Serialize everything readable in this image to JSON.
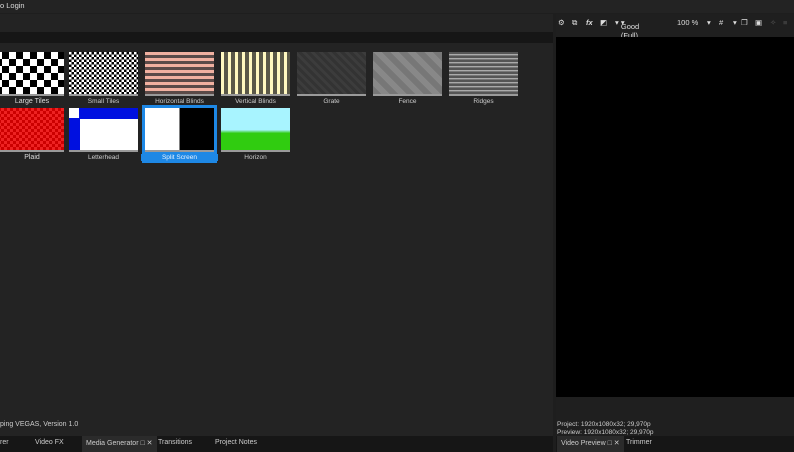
{
  "topbar": {
    "text": "o Login"
  },
  "media": [
    {
      "label": "Large Tiles"
    },
    {
      "label": "Small Tiles"
    },
    {
      "label": "Horizontal Blinds"
    },
    {
      "label": "Vertical Blinds"
    },
    {
      "label": "Grate"
    },
    {
      "label": "Fence"
    },
    {
      "label": "Ridges"
    },
    {
      "label": "Plaid"
    },
    {
      "label": "Letterhead"
    },
    {
      "label": "Split Screen",
      "selected": true
    },
    {
      "label": "Horizon"
    }
  ],
  "status": "ping VEGAS, Version 1.0",
  "tabs_left": [
    "rer",
    "Video FX",
    "Media Generator",
    "Transitions",
    "Project Notes"
  ],
  "preview": {
    "quality": "Good (Full)",
    "zoom": "100 %",
    "project": "Project:  1920x1080x32; 29,970p",
    "preview": "Preview:  1920x1080x32; 29,970p"
  },
  "tabs_right": [
    "Video Preview",
    "Trimmer"
  ],
  "close_glyph": "✕",
  "float_glyph": "□"
}
